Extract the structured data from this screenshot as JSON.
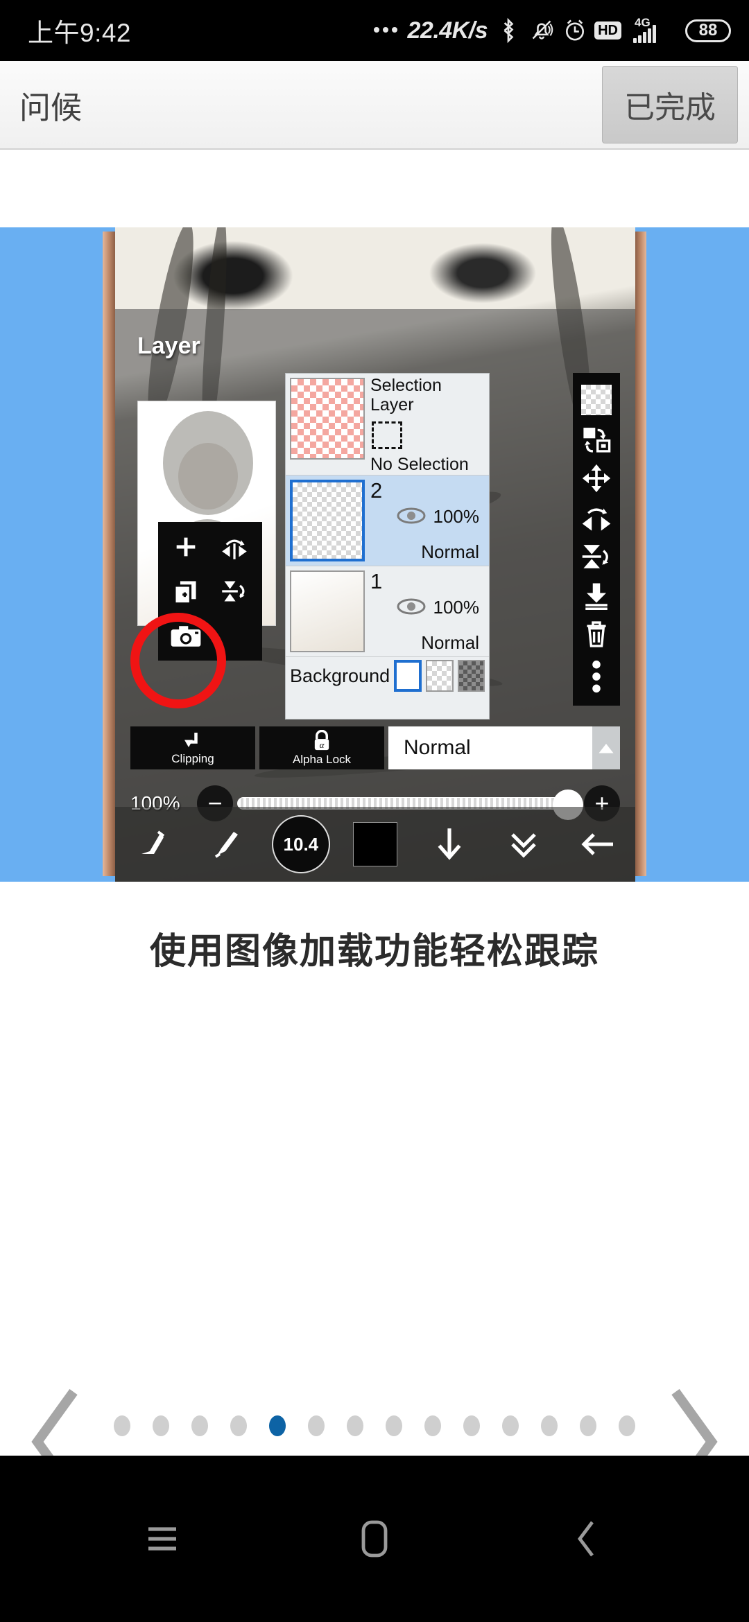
{
  "statusbar": {
    "time": "上午9:42",
    "network_speed": "22.4K/s",
    "icons": [
      "bluetooth-icon",
      "mute-bell-icon",
      "alarm-clock-icon",
      "hd-icon",
      "4g-signal-icon"
    ],
    "hd_label": "HD",
    "network_gen": "4G",
    "battery_level": "88"
  },
  "titlebar": {
    "title": "问候",
    "done_label": "已完成"
  },
  "hero": {
    "background_color": "#69aff2",
    "panel_title": "Layer",
    "selection_layer": {
      "name": "Selection Layer",
      "status": "No Selection"
    },
    "layers": [
      {
        "name": "2",
        "opacity": "100%",
        "blend": "Normal",
        "selected": true
      },
      {
        "name": "1",
        "opacity": "100%",
        "blend": "Normal",
        "selected": false
      }
    ],
    "background_row": {
      "label": "Background",
      "swatches": [
        "white-swatch",
        "transparent-swatch",
        "dark-checker-swatch"
      ],
      "selected_index": 0
    },
    "left_tools": [
      "add-layer-icon",
      "flip-horizontal-icon",
      "duplicate-layer-icon",
      "flip-vertical-icon",
      "camera-icon"
    ],
    "highlighted_tool": "camera-icon",
    "right_tools": [
      "checkerboard-icon",
      "swap-layers-icon",
      "move-icon",
      "flip-horizontal-icon",
      "flip-vertical-icon",
      "merge-down-icon",
      "delete-layer-icon",
      "more-options-icon"
    ],
    "bottom_controls": {
      "clipping_label": "Clipping",
      "alpha_lock_label": "Alpha Lock",
      "blend_mode": "Normal",
      "opacity_value": "100%"
    },
    "canvas_toolbar": {
      "brush_size": "10.4",
      "items": [
        "eraser-icon",
        "brush-icon",
        "brush-size-icon",
        "color-swatch-icon",
        "download-icon",
        "collapse-icon",
        "back-icon"
      ]
    }
  },
  "caption": "使用图像加载功能轻松跟踪",
  "pager": {
    "total": 14,
    "active_index": 4,
    "prev_label": "prev-arrow-icon",
    "next_label": "next-arrow-icon"
  },
  "navbar": {
    "items": [
      "recents-icon",
      "home-icon",
      "back-icon"
    ]
  }
}
